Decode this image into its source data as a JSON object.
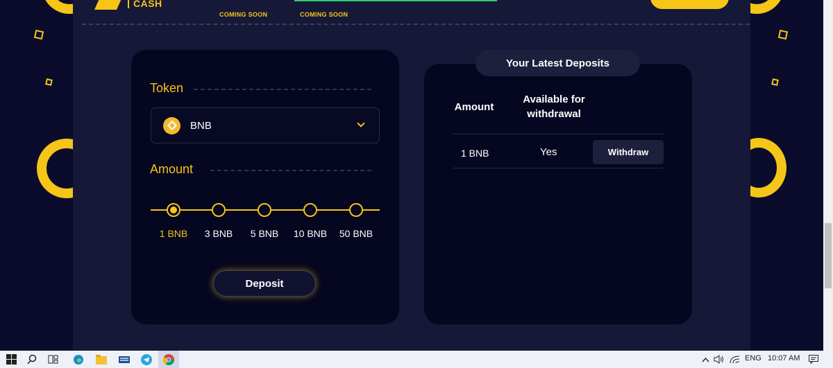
{
  "header": {
    "logo_text": "CASH",
    "coming_soon_1": "COMING SOON",
    "coming_soon_2": "COMING SOON"
  },
  "deposit_form": {
    "token_label": "Token",
    "token_selected": "BNB",
    "amount_label": "Amount",
    "amount_options": [
      "1 BNB",
      "3 BNB",
      "5 BNB",
      "10 BNB",
      "50 BNB"
    ],
    "selected_index": 0,
    "deposit_button": "Deposit"
  },
  "latest_deposits": {
    "title": "Your Latest Deposits",
    "columns": [
      "Amount",
      "Available for withdrawal"
    ],
    "rows": [
      {
        "amount": "1 BNB",
        "available": "Yes",
        "action": "Withdraw"
      }
    ]
  },
  "taskbar": {
    "language": "ENG",
    "time": "10:07 AM"
  },
  "colors": {
    "accent": "#f5c518",
    "background": "#0b0c2c",
    "card": "#05061f"
  }
}
